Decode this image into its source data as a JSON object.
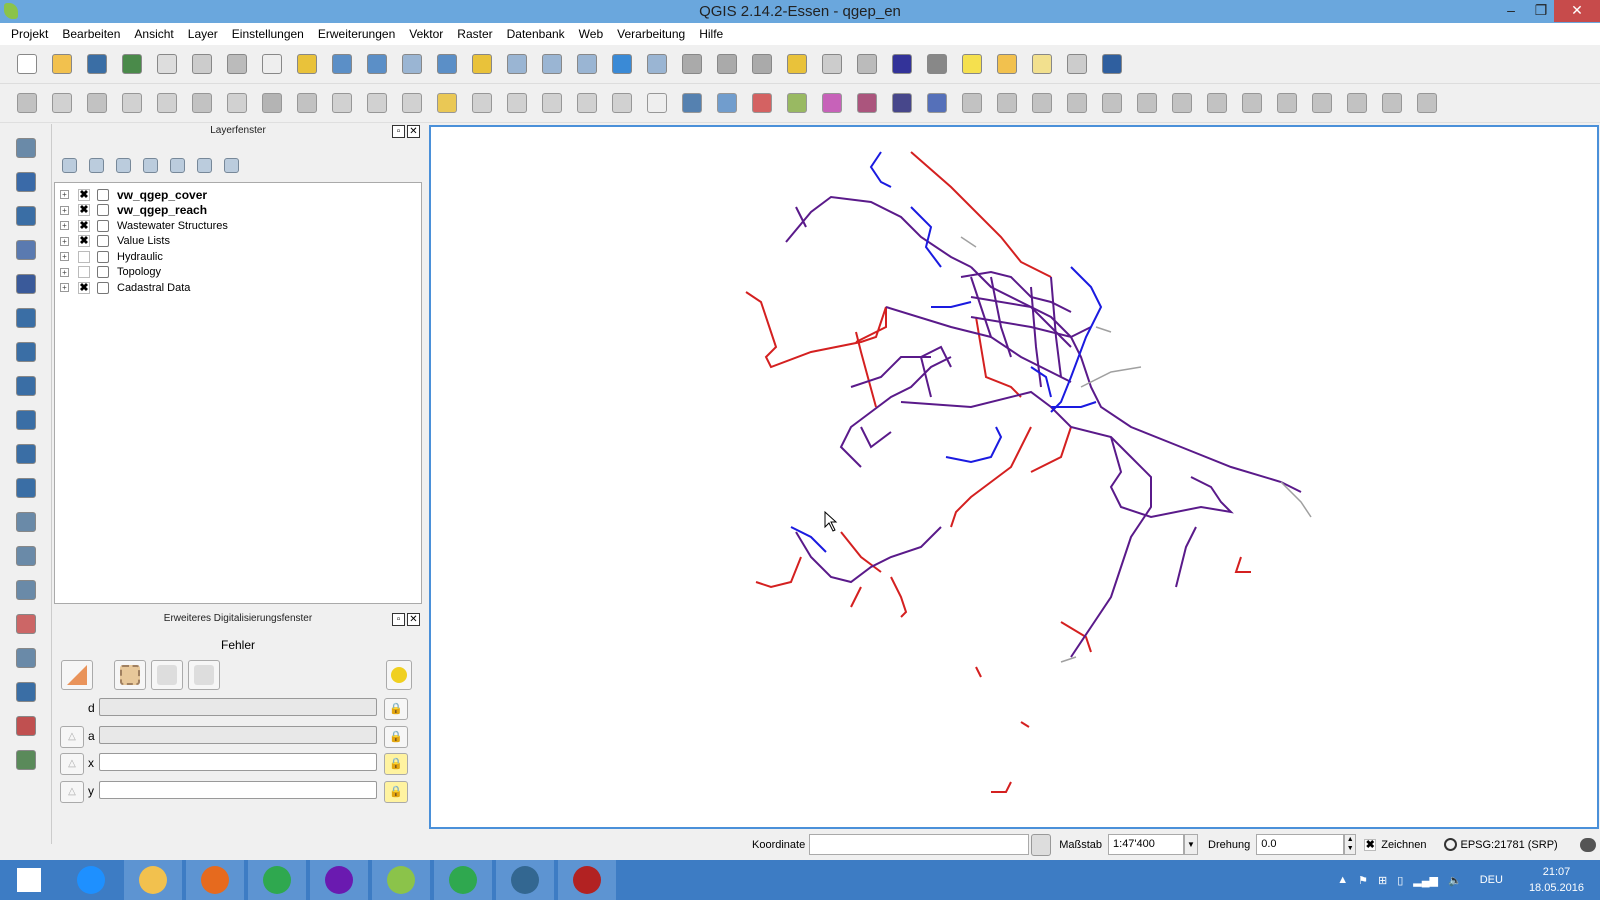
{
  "window": {
    "title": "QGIS 2.14.2-Essen - qgep_en",
    "minimize": "–",
    "maximize": "❐",
    "close": "✕"
  },
  "menu": [
    "Projekt",
    "Bearbeiten",
    "Ansicht",
    "Layer",
    "Einstellungen",
    "Erweiterungen",
    "Vektor",
    "Raster",
    "Datenbank",
    "Web",
    "Verarbeitung",
    "Hilfe"
  ],
  "toolbar1": [
    {
      "icon": "new-project-icon",
      "color": "#ffffff"
    },
    {
      "icon": "open-folder-icon",
      "color": "#f2c14e"
    },
    {
      "icon": "save-icon",
      "color": "#3a6ea5"
    },
    {
      "icon": "save-as-icon",
      "color": "#4a8a4a"
    },
    {
      "icon": "new-composer-icon",
      "color": "#dddddd"
    },
    {
      "icon": "composer-manager-icon",
      "color": "#cccccc"
    },
    {
      "icon": "touch-select-icon",
      "color": "#bbbbbb"
    },
    {
      "icon": "pan-hand-icon",
      "color": "#eeeeee"
    },
    {
      "icon": "pan-to-selection-icon",
      "color": "#e9c23a"
    },
    {
      "icon": "zoom-in-icon",
      "color": "#5b8fc7"
    },
    {
      "icon": "zoom-out-icon",
      "color": "#5b8fc7"
    },
    {
      "icon": "zoom-native-icon",
      "color": "#9ab5d3"
    },
    {
      "icon": "zoom-full-icon",
      "color": "#5b8fc7"
    },
    {
      "icon": "zoom-selection-icon",
      "color": "#e9c23a"
    },
    {
      "icon": "zoom-layer-icon",
      "color": "#9ab5d3"
    },
    {
      "icon": "zoom-last-icon",
      "color": "#9ab5d3"
    },
    {
      "icon": "zoom-next-icon",
      "color": "#9ab5d3"
    },
    {
      "icon": "refresh-icon",
      "color": "#3a8ad6"
    },
    {
      "icon": "identify-icon",
      "color": "#9ab5d3"
    },
    {
      "icon": "action-icon",
      "color": "#aaaaaa"
    },
    {
      "icon": "select-features-icon",
      "color": "#aaaaaa"
    },
    {
      "icon": "select-expression-icon",
      "color": "#aaaaaa"
    },
    {
      "icon": "deselect-icon",
      "color": "#e9c23a"
    },
    {
      "icon": "attribute-table-icon",
      "color": "#cccccc"
    },
    {
      "icon": "field-calculator-icon",
      "color": "#bbbbbb"
    },
    {
      "icon": "statistics-sum-icon",
      "color": "#333399"
    },
    {
      "icon": "measure-icon",
      "color": "#888888"
    },
    {
      "icon": "map-tips-icon",
      "color": "#f5e04e"
    },
    {
      "icon": "new-bookmark-icon",
      "color": "#f2c14e"
    },
    {
      "icon": "show-bookmarks-icon",
      "color": "#f2e08e"
    },
    {
      "icon": "text-annotation-icon",
      "color": "#cccccc"
    },
    {
      "icon": "help-icon",
      "color": "#2f5f9f"
    }
  ],
  "toolbar2": [
    {
      "icon": "current-edits-icon",
      "color": "#bbbbbb"
    },
    {
      "icon": "toggle-editing-icon",
      "color": "#cccccc"
    },
    {
      "icon": "save-edits-icon",
      "color": "#bbbbbb"
    },
    {
      "icon": "add-feature-icon",
      "color": "#cccccc"
    },
    {
      "icon": "node-tool-icon",
      "color": "#cccccc"
    },
    {
      "icon": "move-feature-icon",
      "color": "#bbbbbb"
    },
    {
      "icon": "vertex-icon",
      "color": "#cccccc"
    },
    {
      "icon": "delete-selected-icon",
      "color": "#aaaaaa"
    },
    {
      "icon": "cut-icon",
      "color": "#bbbbbb"
    },
    {
      "icon": "copy-icon",
      "color": "#cccccc"
    },
    {
      "icon": "paste-icon",
      "color": "#cccccc"
    },
    {
      "icon": "label-icon",
      "color": "#cccccc"
    },
    {
      "icon": "label-highlight-icon",
      "color": "#e9c23a"
    },
    {
      "icon": "label-pin-icon",
      "color": "#cccccc"
    },
    {
      "icon": "label-show-icon",
      "color": "#cccccc"
    },
    {
      "icon": "label-move-icon",
      "color": "#cccccc"
    },
    {
      "icon": "label-rotate-icon",
      "color": "#cccccc"
    },
    {
      "icon": "label-change-icon",
      "color": "#cccccc"
    },
    {
      "icon": "csw-icon",
      "color": "#eeeeee"
    },
    {
      "icon": "python-icon",
      "color": "#3a6ea5"
    },
    {
      "icon": "grid-plugin-icon",
      "color": "#5b8fc7"
    },
    {
      "icon": "georeferencer-icon",
      "color": "#d04a4a"
    },
    {
      "icon": "qgep-digitize-icon",
      "color": "#8bb04a"
    },
    {
      "icon": "qgep-reach-icon",
      "color": "#c04ab0"
    },
    {
      "icon": "qgep-flow-icon",
      "color": "#a03a6a"
    },
    {
      "icon": "profile-icon",
      "color": "#2a2a7a"
    },
    {
      "icon": "sql-icon",
      "color": "#3a5ab0"
    },
    {
      "icon": "adv-edit-1-icon",
      "color": "#bbbbbb"
    },
    {
      "icon": "adv-edit-2-icon",
      "color": "#bbbbbb"
    },
    {
      "icon": "adv-edit-3-icon",
      "color": "#bbbbbb"
    },
    {
      "icon": "adv-edit-4-icon",
      "color": "#bbbbbb"
    },
    {
      "icon": "adv-edit-5-icon",
      "color": "#bbbbbb"
    },
    {
      "icon": "adv-edit-6-icon",
      "color": "#bbbbbb"
    },
    {
      "icon": "adv-edit-7-icon",
      "color": "#bbbbbb"
    },
    {
      "icon": "adv-edit-8-icon",
      "color": "#bbbbbb"
    },
    {
      "icon": "adv-edit-9-icon",
      "color": "#bbbbbb"
    },
    {
      "icon": "adv-edit-10-icon",
      "color": "#bbbbbb"
    },
    {
      "icon": "adv-edit-11-icon",
      "color": "#bbbbbb"
    },
    {
      "icon": "adv-edit-12-icon",
      "color": "#bbbbbb"
    },
    {
      "icon": "adv-edit-13-icon",
      "color": "#bbbbbb"
    },
    {
      "icon": "adv-edit-14-icon",
      "color": "#bbbbbb"
    }
  ],
  "leftbar": [
    {
      "icon": "add-vector-layer-icon",
      "color": "#6a8aa8"
    },
    {
      "icon": "add-raster-layer-icon",
      "color": "#3a6aa8"
    },
    {
      "icon": "add-postgis-layer-icon",
      "color": "#3a6ea5"
    },
    {
      "icon": "add-spatialite-layer-icon",
      "color": "#5a7ab0"
    },
    {
      "icon": "add-mssql-layer-icon",
      "color": "#3a5a9a"
    },
    {
      "icon": "add-oracle-layer-icon",
      "color": "#3a6ea5"
    },
    {
      "icon": "add-db2-layer-icon",
      "color": "#3a6ea5"
    },
    {
      "icon": "add-wms-layer-icon",
      "color": "#3a6ea5"
    },
    {
      "icon": "add-wcs-layer-icon",
      "color": "#3a6ea5"
    },
    {
      "icon": "add-wfs-layer-icon",
      "color": "#3a6ea5"
    },
    {
      "icon": "add-delimited-text-icon",
      "color": "#3a6ea5"
    },
    {
      "icon": "add-virtual-layer-icon",
      "color": "#6a8aa8"
    },
    {
      "icon": "new-shapefile-icon",
      "color": "#6a8aa8"
    },
    {
      "icon": "new-spatialite-icon",
      "color": "#6a8aa8"
    },
    {
      "icon": "crosshair-icon",
      "color": "#cc6666"
    },
    {
      "icon": "digitize-point-icon",
      "color": "#6a8aa8"
    },
    {
      "icon": "digitize-tools-icon",
      "color": "#3a6ea5"
    },
    {
      "icon": "vertex-editor-icon",
      "color": "#c05050"
    },
    {
      "icon": "topology-checker-icon",
      "color": "#5a8a5a"
    }
  ],
  "layers_panel": {
    "title": "Layerfenster",
    "tools": [
      "add-group-icon",
      "eye-icon",
      "filter-icon",
      "expression-filter-icon",
      "expand-all-icon",
      "collapse-all-icon",
      "remove-layer-icon"
    ],
    "layers": [
      {
        "name": "vw_qgep_cover",
        "checked": true,
        "bold": true,
        "icon": "point-layer-icon"
      },
      {
        "name": "vw_qgep_reach",
        "checked": true,
        "bold": true,
        "icon": "line-layer-icon"
      },
      {
        "name": "Wastewater Structures",
        "checked": true,
        "bold": false,
        "icon": "group-icon"
      },
      {
        "name": "Value Lists",
        "checked": true,
        "bold": false,
        "icon": "group-icon"
      },
      {
        "name": "Hydraulic",
        "checked": false,
        "bold": false,
        "icon": "group-icon"
      },
      {
        "name": "Topology",
        "checked": false,
        "bold": false,
        "icon": "group-icon"
      },
      {
        "name": "Cadastral Data",
        "checked": true,
        "bold": false,
        "icon": "group-icon"
      }
    ]
  },
  "digitizing_panel": {
    "title": "Erweiteres Digitalisierungsfenster",
    "status": "Fehler",
    "fields": [
      {
        "label": "d",
        "value": "",
        "enabled": false
      },
      {
        "label": "a",
        "value": "",
        "enabled": false
      },
      {
        "label": "x",
        "value": "",
        "enabled": true
      },
      {
        "label": "y",
        "value": "",
        "enabled": true
      }
    ]
  },
  "statusbar": {
    "coordinate_label": "Koordinate",
    "coordinate_value": "",
    "scale_label": "Maßstab",
    "scale_value": "1:47'400",
    "rotation_label": "Drehung",
    "rotation_value": "0.0",
    "render_label": "Zeichnen",
    "render_checked": true,
    "crs": "EPSG:21781 (SRP)"
  },
  "map": {
    "colors": {
      "red": "#d42020",
      "purple": "#5a1a8a",
      "blue": "#1a1ae0",
      "gray": "#a0a0a0"
    }
  },
  "taskbar": {
    "apps": [
      "windows-start-icon",
      "internet-explorer-icon",
      "file-explorer-icon",
      "firefox-icon",
      "chrome-icon",
      "search-app-icon",
      "qgis-icon",
      "chrome-icon",
      "postgresql-icon",
      "pgadmin-icon"
    ],
    "language": "DEU",
    "time": "21:07",
    "date": "18.05.2016"
  }
}
